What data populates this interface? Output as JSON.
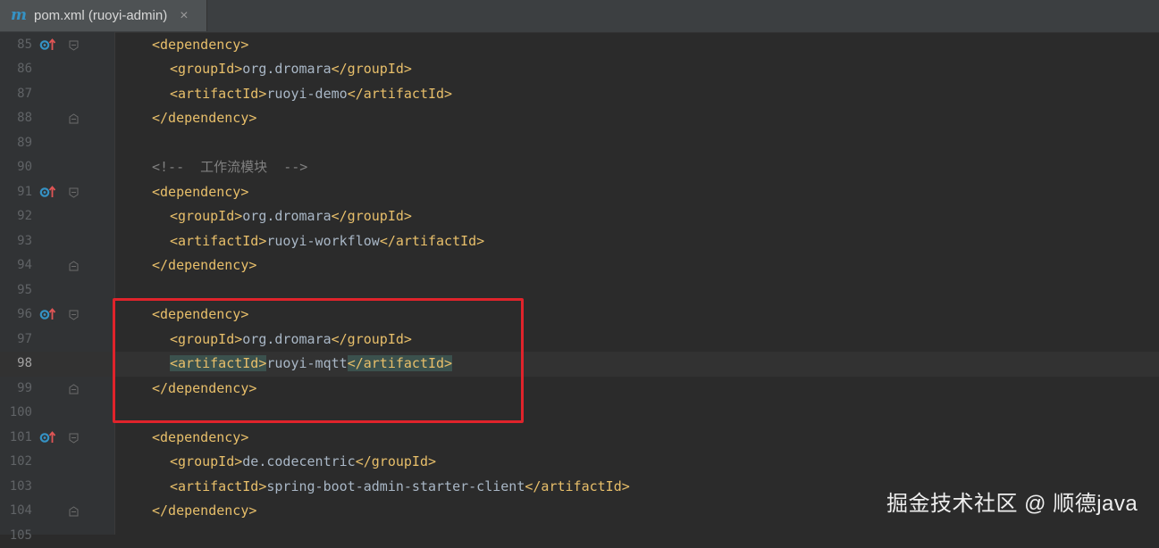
{
  "tab": {
    "icon": "maven-m-icon",
    "icon_glyph": "m",
    "title": "pom.xml (ruoyi-admin)",
    "close_glyph": "×"
  },
  "lines": [
    {
      "num": "85",
      "indent": 2,
      "parts": [
        {
          "t": "tag",
          "v": "<dependency>"
        }
      ],
      "gutter": "override",
      "fold": "start"
    },
    {
      "num": "86",
      "indent": 3,
      "parts": [
        {
          "t": "tag",
          "v": "<groupId>"
        },
        {
          "t": "txt",
          "v": "org.dromara"
        },
        {
          "t": "tag",
          "v": "</groupId>"
        }
      ]
    },
    {
      "num": "87",
      "indent": 3,
      "parts": [
        {
          "t": "tag",
          "v": "<artifactId>"
        },
        {
          "t": "txt",
          "v": "ruoyi-demo"
        },
        {
          "t": "tag",
          "v": "</artifactId>"
        }
      ]
    },
    {
      "num": "88",
      "indent": 2,
      "parts": [
        {
          "t": "tag",
          "v": "</dependency>"
        }
      ],
      "fold": "end"
    },
    {
      "num": "89",
      "indent": 0,
      "parts": []
    },
    {
      "num": "90",
      "indent": 2,
      "parts": [
        {
          "t": "cmt",
          "v": "<!--  工作流模块  -->"
        }
      ]
    },
    {
      "num": "91",
      "indent": 2,
      "parts": [
        {
          "t": "tag",
          "v": "<dependency>"
        }
      ],
      "gutter": "override",
      "fold": "start"
    },
    {
      "num": "92",
      "indent": 3,
      "parts": [
        {
          "t": "tag",
          "v": "<groupId>"
        },
        {
          "t": "txt",
          "v": "org.dromara"
        },
        {
          "t": "tag",
          "v": "</groupId>"
        }
      ]
    },
    {
      "num": "93",
      "indent": 3,
      "parts": [
        {
          "t": "tag",
          "v": "<artifactId>"
        },
        {
          "t": "txt",
          "v": "ruoyi-workflow"
        },
        {
          "t": "tag",
          "v": "</artifactId>"
        }
      ]
    },
    {
      "num": "94",
      "indent": 2,
      "parts": [
        {
          "t": "tag",
          "v": "</dependency>"
        }
      ],
      "fold": "end"
    },
    {
      "num": "95",
      "indent": 0,
      "parts": []
    },
    {
      "num": "96",
      "indent": 2,
      "parts": [
        {
          "t": "tag",
          "v": "<dependency>"
        }
      ],
      "gutter": "override",
      "fold": "start"
    },
    {
      "num": "97",
      "indent": 3,
      "parts": [
        {
          "t": "tag",
          "v": "<groupId>"
        },
        {
          "t": "txt",
          "v": "org.dromara"
        },
        {
          "t": "tag",
          "v": "</groupId>"
        }
      ]
    },
    {
      "num": "98",
      "indent": 3,
      "parts": [
        {
          "t": "tag",
          "v": "<artifactId>",
          "hl": true
        },
        {
          "t": "txt",
          "v": "ruoyi-mqtt"
        },
        {
          "t": "tag",
          "v": "</artifactId>",
          "hl": true
        }
      ],
      "current": true
    },
    {
      "num": "99",
      "indent": 2,
      "parts": [
        {
          "t": "tag",
          "v": "</dependency>"
        }
      ],
      "fold": "end"
    },
    {
      "num": "100",
      "indent": 0,
      "parts": []
    },
    {
      "num": "101",
      "indent": 2,
      "parts": [
        {
          "t": "tag",
          "v": "<dependency>"
        }
      ],
      "gutter": "override",
      "fold": "start"
    },
    {
      "num": "102",
      "indent": 3,
      "parts": [
        {
          "t": "tag",
          "v": "<groupId>"
        },
        {
          "t": "txt",
          "v": "de.codecentric"
        },
        {
          "t": "tag",
          "v": "</groupId>"
        }
      ]
    },
    {
      "num": "103",
      "indent": 3,
      "parts": [
        {
          "t": "tag",
          "v": "<artifactId>"
        },
        {
          "t": "txt",
          "v": "spring-boot-admin-starter-client"
        },
        {
          "t": "tag",
          "v": "</artifactId>"
        }
      ]
    },
    {
      "num": "104",
      "indent": 2,
      "parts": [
        {
          "t": "tag",
          "v": "</dependency>"
        }
      ],
      "fold": "end"
    },
    {
      "num": "105",
      "indent": 0,
      "parts": []
    }
  ],
  "highlight_box": {
    "color": "#e0232b",
    "covers_lines": [
      "96",
      "97",
      "98",
      "99",
      "100"
    ]
  },
  "watermark": "掘金技术社区 @ 顺德java",
  "colors": {
    "background": "#2b2b2b",
    "gutter": "#313335",
    "tag": "#e8bf6a",
    "text": "#a9b7c6",
    "comment": "#808080",
    "match_highlight": "#3b514d"
  }
}
